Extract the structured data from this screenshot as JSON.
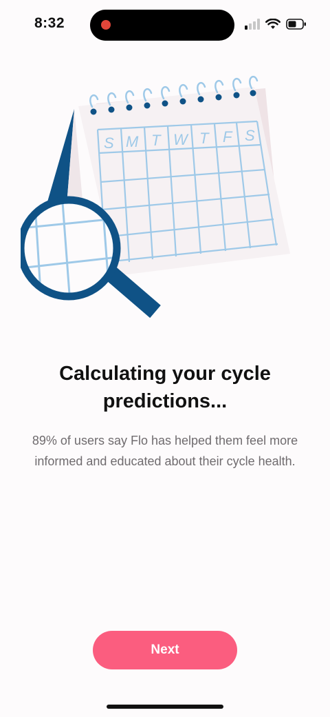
{
  "status_bar": {
    "time": "8:32",
    "icons": [
      "recording-dot",
      "cellular-signal-icon",
      "wifi-icon",
      "battery-icon"
    ]
  },
  "illustration": {
    "name": "calendar-with-magnifying-glass",
    "weekday_letters": [
      "S",
      "M",
      "T",
      "W",
      "T",
      "F",
      "S"
    ]
  },
  "content": {
    "title": "Calculating your cycle predictions...",
    "subtitle": "89% of users say Flo has helped them feel more informed and educated about their cycle health."
  },
  "actions": {
    "next_label": "Next"
  },
  "colors": {
    "background": "#fdfbfc",
    "button": "#fb5d7f",
    "navy": "#0f5286",
    "grid": "#9ec9e8"
  }
}
